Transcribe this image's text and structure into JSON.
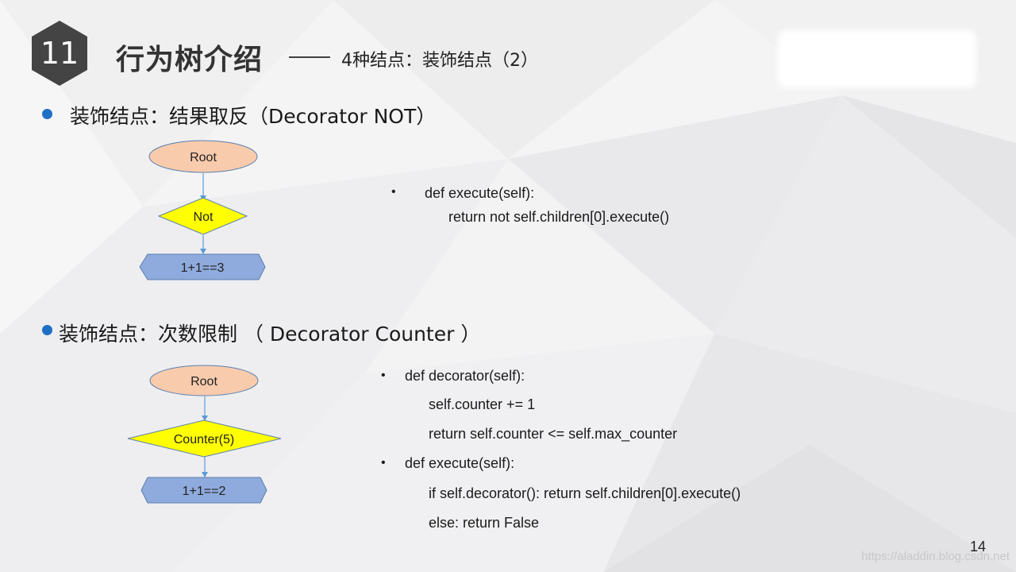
{
  "slide": {
    "section_number": "11",
    "title": "行为树介绍",
    "subtitle": "4种结点：装饰结点（2）",
    "page_number": "14",
    "watermark": "https://aladdin.blog.csdn.net"
  },
  "section_not": {
    "heading": "装饰结点：结果取反（Decorator NOT）",
    "diagram": {
      "root_label": "Root",
      "decorator_label": "Not",
      "leaf_label": "1+1==3"
    },
    "code": {
      "line1": "def execute(self):",
      "line2": "return not self.children[0].execute()"
    }
  },
  "section_counter": {
    "heading": "装饰结点：次数限制 （ Decorator Counter ）",
    "diagram": {
      "root_label": "Root",
      "decorator_label": "Counter(5)",
      "leaf_label": "1+1==2"
    },
    "code": {
      "line1": "def decorator(self):",
      "line2": "self.counter += 1",
      "line3": "return self.counter <= self.max_counter",
      "line4": "def execute(self):",
      "line5": "if self.decorator():  return self.children[0].execute()",
      "line6": "else: return False"
    }
  },
  "colors": {
    "badge": "#444444",
    "bullet": "#1f6fc5",
    "root_fill": "#f8cbad",
    "decorator_fill": "#ffff00",
    "leaf_fill": "#8faadc",
    "connector": "#5b9bd5"
  }
}
